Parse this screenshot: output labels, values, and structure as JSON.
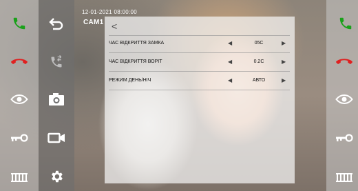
{
  "osd": {
    "datetime": "12-01-2021 08:00:00",
    "camera": "CAM1"
  },
  "colors": {
    "call_accept": "#1aa11a",
    "call_end": "#e02020",
    "icon_white": "#ffffff"
  },
  "left_rail": [
    {
      "icon": "phone-accept-icon"
    },
    {
      "icon": "phone-hangup-icon"
    },
    {
      "icon": "eye-icon"
    },
    {
      "icon": "key-icon"
    },
    {
      "icon": "gate-icon"
    }
  ],
  "toolbar": [
    {
      "icon": "back-arrow-icon"
    },
    {
      "icon": "call-transfer-icon"
    },
    {
      "icon": "camera-icon"
    },
    {
      "icon": "video-record-icon"
    },
    {
      "icon": "gear-icon"
    }
  ],
  "settings": {
    "back_glyph": "<",
    "rows": [
      {
        "label": "ЧАС ВІДКРИТТЯ ЗАМКА",
        "value": "05С"
      },
      {
        "label": "ЧАС ВІДКРИТТЯ ВОРІТ",
        "value": "0.2С"
      },
      {
        "label": "РЕЖИМ ДЕНЬ/НІЧ",
        "value": "АВТО"
      }
    ],
    "arrow_left": "◀",
    "arrow_right": "▶"
  }
}
